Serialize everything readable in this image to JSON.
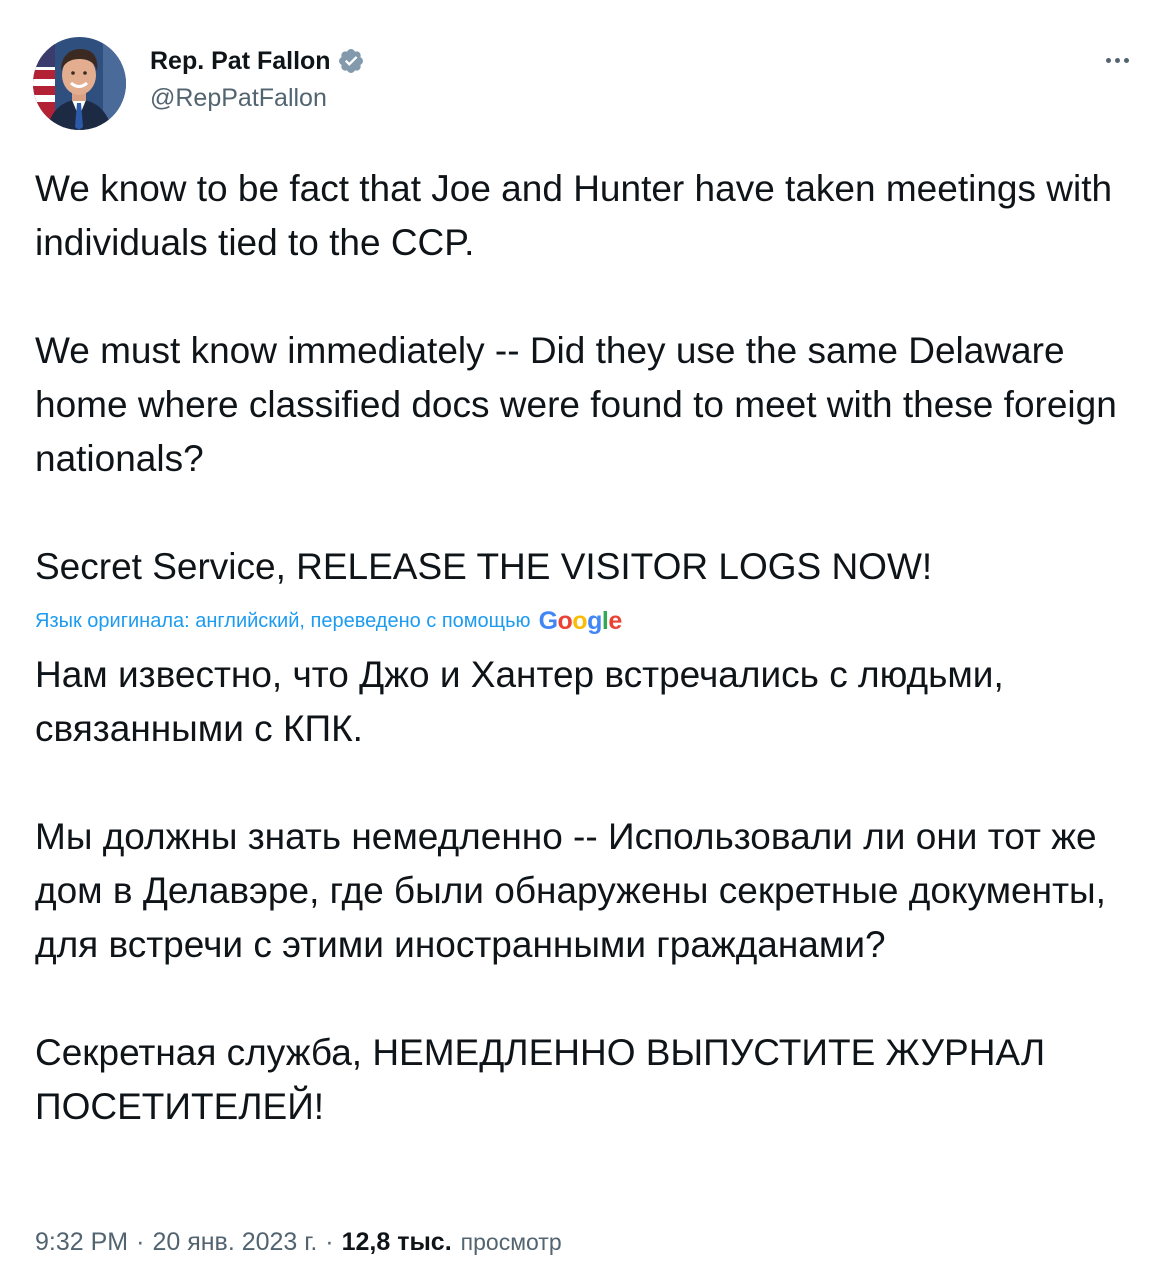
{
  "author": {
    "display_name": "Rep. Pat Fallon",
    "handle": "@RepPatFallon",
    "avatar_icon": "profile-photo-avatar",
    "verified_icon": "verified-badge-icon",
    "verified_color": "#829aab"
  },
  "menu": {
    "more_icon": "more-options-icon"
  },
  "tweet": {
    "paragraphs": [
      "We know to be fact that Joe and Hunter have taken meetings with individuals tied to the CCP.",
      "We must know immediately -- Did they use the same Delaware home where classified docs were found to meet with these foreign nationals?",
      "Secret Service, RELEASE THE VISITOR LOGS NOW!"
    ]
  },
  "translation": {
    "notice": "Язык оригинала: английский, переведено с помощью",
    "provider_logo": "Google",
    "paragraphs": [
      "Нам известно, что Джо и Хантер встречались с людьми, связанными с КПК.",
      "Мы должны знать немедленно -- Использовали ли они тот же дом в Делавэре, где были обнаружены секретные документы, для встречи с этими иностранными гражданами?",
      "Секретная служба, НЕМЕДЛЕННО ВЫПУСТИТЕ ЖУРНАЛ ПОСЕТИТЕЛЕЙ!"
    ]
  },
  "meta": {
    "time": "9:32 PM",
    "separator": "·",
    "date": "20 янв. 2023 г.",
    "views_count": "12,8 тыс.",
    "views_label": "просмотр"
  },
  "colors": {
    "text_primary": "#0f1419",
    "text_secondary": "#536471",
    "link_blue": "#1d9bf0"
  }
}
